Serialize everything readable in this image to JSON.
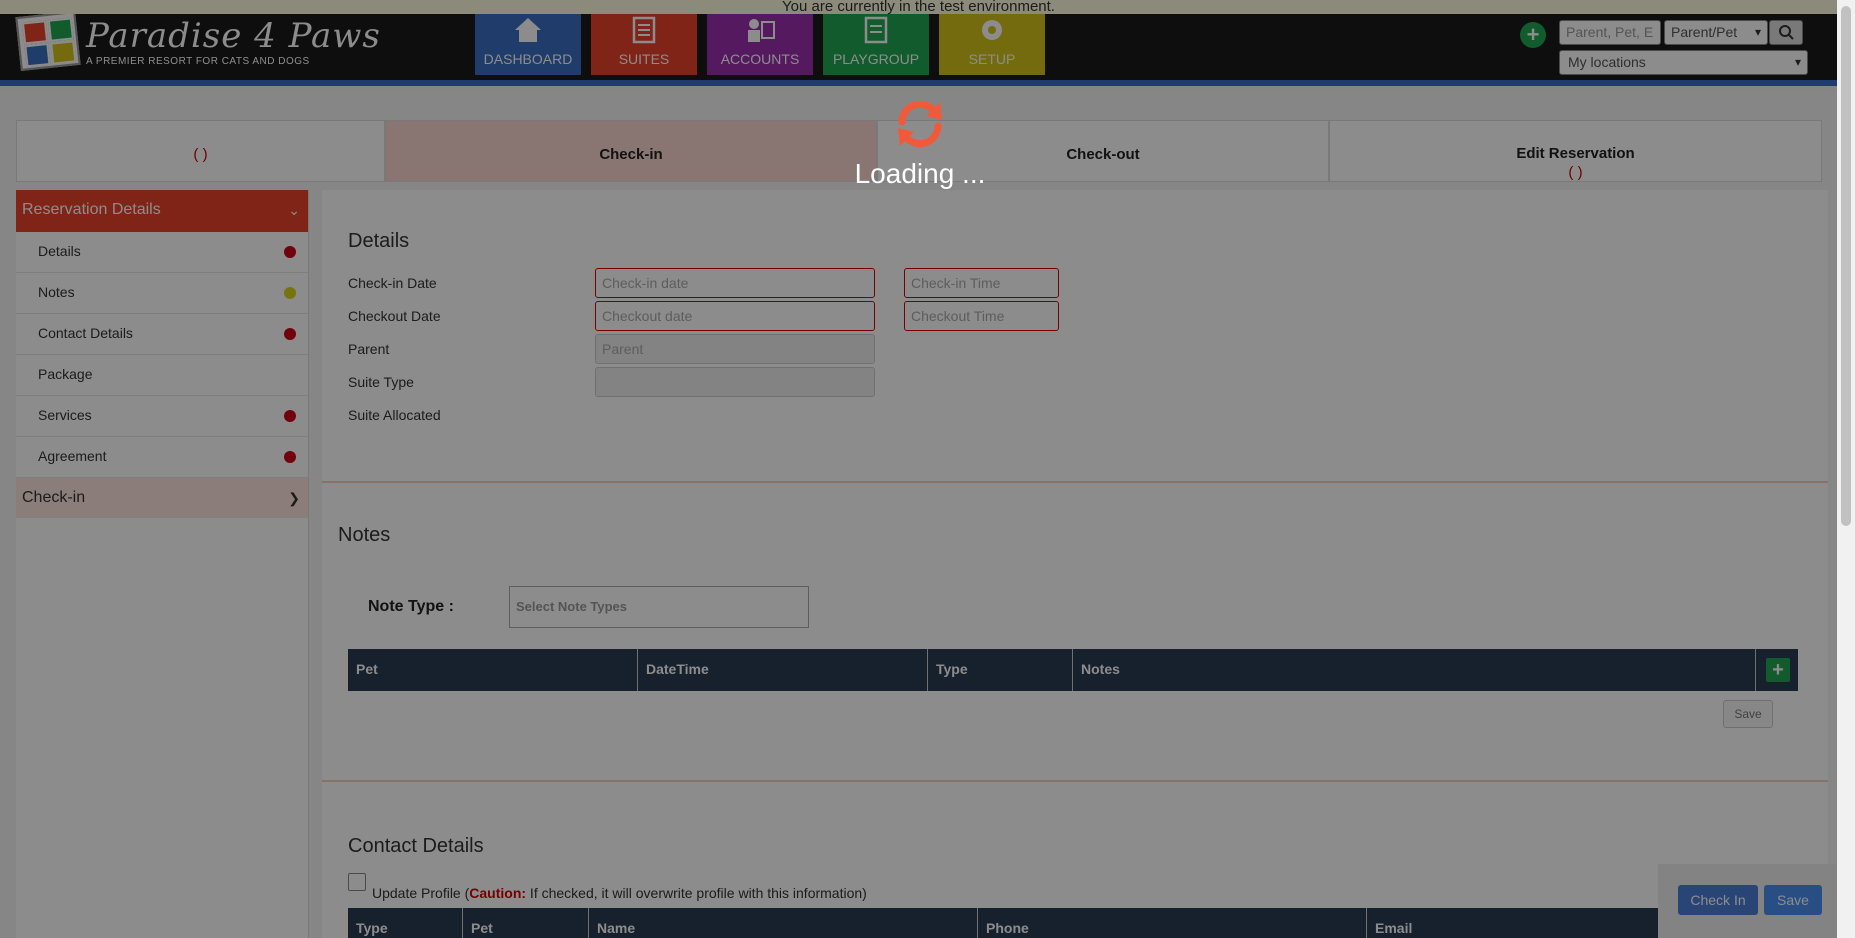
{
  "banner": "You are currently in the test environment.",
  "logo": {
    "title": "Paradise 4 Paws",
    "subtitle": "A PREMIER RESORT FOR CATS AND DOGS"
  },
  "nav": [
    {
      "label": "DASHBOARD",
      "color": "#3b6ec2",
      "icon": "dashboard-icon"
    },
    {
      "label": "SUITES",
      "color": "#e8432b",
      "icon": "suites-icon"
    },
    {
      "label": "ACCOUNTS",
      "color": "#9b2fae",
      "icon": "accounts-icon"
    },
    {
      "label": "PLAYGROUP",
      "color": "#1fa650",
      "icon": "playgroup-icon"
    },
    {
      "label": "SETUP",
      "color": "#d4c21a",
      "icon": "setup-icon"
    }
  ],
  "header": {
    "search_placeholder": "Parent, Pet, E",
    "search_type": "Parent/Pet",
    "location": "My locations"
  },
  "tabs": [
    {
      "label": "",
      "sub": "( )"
    },
    {
      "label": "Check-in",
      "sub": ""
    },
    {
      "label": "Check-out",
      "sub": ""
    },
    {
      "label": "Edit Reservation",
      "sub": "( )"
    }
  ],
  "sidebar": {
    "header": "Reservation Details",
    "items": [
      {
        "label": "Details",
        "status": "#d0021b"
      },
      {
        "label": "Notes",
        "status": "#d8d41a"
      },
      {
        "label": "Contact Details",
        "status": "#d0021b"
      },
      {
        "label": "Package",
        "status": ""
      },
      {
        "label": "Services",
        "status": "#d0021b"
      },
      {
        "label": "Agreement",
        "status": "#d0021b"
      }
    ],
    "checkin": "Check-in"
  },
  "details": {
    "title": "Details",
    "checkin_date_label": "Check-in Date",
    "checkin_date_placeholder": "Check-in date",
    "checkin_time_placeholder": "Check-in Time",
    "checkout_date_label": "Checkout Date",
    "checkout_date_placeholder": "Checkout date",
    "checkout_time_placeholder": "Checkout Time",
    "parent_label": "Parent",
    "parent_placeholder": "Parent",
    "suite_type_label": "Suite Type",
    "suite_allocated_label": "Suite Allocated"
  },
  "notes": {
    "title": "Notes",
    "note_type_label": "Note Type :",
    "note_type_placeholder": "Select Note Types",
    "columns": [
      "Pet",
      "DateTime",
      "Type",
      "Notes"
    ],
    "save": "Save"
  },
  "contact": {
    "title": "Contact Details",
    "update_profile": "Update Profile (",
    "caution": "Caution:",
    "caution_text": " If checked, it will overwrite profile with this information)",
    "columns": [
      "Type",
      "Pet",
      "Name",
      "Phone",
      "Email"
    ]
  },
  "footer": {
    "checkin": "Check In",
    "save": "Save"
  },
  "loading": "Loading ..."
}
